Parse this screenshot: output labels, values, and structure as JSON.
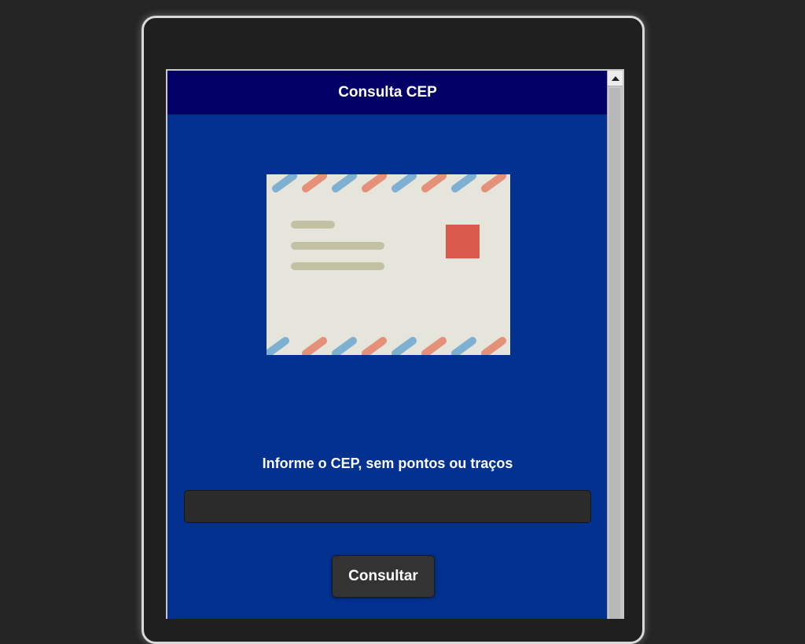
{
  "header": {
    "title": "Consulta CEP"
  },
  "illustration": {
    "icon": "envelope-icon",
    "colors": {
      "paper": "#e6e5dc",
      "stamp": "#da5a4b",
      "stripe_blue": "#7eb0d2",
      "stripe_red": "#e5917a",
      "lines": "#c2c1a3"
    }
  },
  "form": {
    "instruction": "Informe o CEP, sem pontos ou traços",
    "cep_value": "",
    "submit_label": "Consultar"
  },
  "colors": {
    "page_background": "#02318f",
    "header_background": "#020066",
    "device_frame": "#1f1f1f"
  }
}
